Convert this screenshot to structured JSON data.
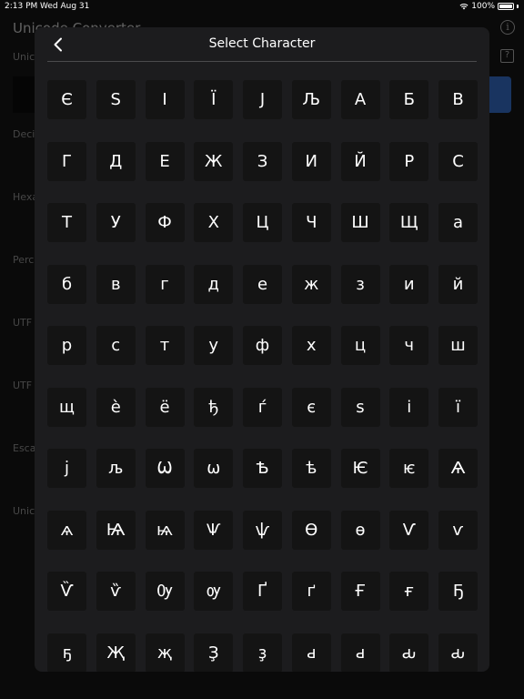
{
  "status_bar": {
    "time": "2:13 PM",
    "date": "Wed Aug 31",
    "battery": "100%"
  },
  "background": {
    "title": "Unicode Converter",
    "labels": [
      "Unic",
      "Deci",
      "Hexa",
      "Perc",
      "UTF",
      "UTF",
      "Esca",
      "Unic"
    ]
  },
  "sheet": {
    "title": "Select Character",
    "back_icon": "chevron-left-icon"
  },
  "characters": [
    [
      "Є",
      "S",
      "I",
      "Ї",
      "J",
      "Љ",
      "А",
      "Б",
      "В"
    ],
    [
      "Г",
      "Д",
      "Е",
      "Ж",
      "З",
      "И",
      "Й",
      "Р",
      "С"
    ],
    [
      "Т",
      "У",
      "Ф",
      "Х",
      "Ц",
      "Ч",
      "Ш",
      "Щ",
      "а"
    ],
    [
      "б",
      "в",
      "г",
      "д",
      "е",
      "ж",
      "з",
      "и",
      "й"
    ],
    [
      "р",
      "с",
      "т",
      "у",
      "ф",
      "х",
      "ц",
      "ч",
      "ш"
    ],
    [
      "щ",
      "è",
      "ё",
      "ђ",
      "ѓ",
      "є",
      "ѕ",
      "і",
      "ї"
    ],
    [
      "ј",
      "љ",
      "Ѡ",
      "ѡ",
      "Ѣ",
      "ѣ",
      "Ѥ",
      "ѥ",
      "Ѧ"
    ],
    [
      "ѧ",
      "Ѩ",
      "ѩ",
      "Ѱ",
      "ѱ",
      "Ѳ",
      "ѳ",
      "Ѵ",
      "ѵ"
    ],
    [
      "Ѷ",
      "ѷ",
      "Ѹ",
      "ѹ",
      "Ґ",
      "ґ",
      "Ғ",
      "ғ",
      "Ҕ"
    ],
    [
      "ҕ",
      "Җ",
      "җ",
      "Ҙ",
      "ҙ",
      "ԁ",
      "ԁ",
      "ԃ",
      "ԃ"
    ]
  ]
}
